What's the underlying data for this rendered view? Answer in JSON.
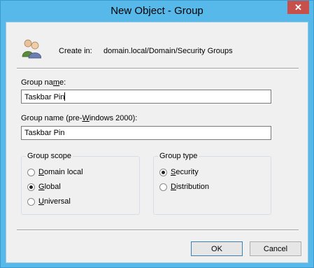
{
  "window": {
    "title": "New Object - Group",
    "close_glyph": "✕"
  },
  "header": {
    "icon": "users-group-icon",
    "create_in_label": "Create in:",
    "create_in_value": "domain.local/Domain/Security Groups"
  },
  "group_name": {
    "label_pre": "Group na",
    "label_u": "m",
    "label_post": "e:",
    "value": "Taskbar Pin"
  },
  "group_name_pre2000": {
    "label_pre": "Group name (pre-",
    "label_u": "W",
    "label_post": "indows 2000):",
    "value": "Taskbar Pin"
  },
  "group_scope": {
    "legend": "Group scope",
    "options": [
      {
        "u": "D",
        "rest": "omain local",
        "selected": false
      },
      {
        "u": "G",
        "rest": "lobal",
        "selected": true
      },
      {
        "u": "U",
        "rest": "niversal",
        "selected": false
      }
    ]
  },
  "group_type": {
    "legend": "Group type",
    "options": [
      {
        "u": "S",
        "rest": "ecurity",
        "selected": true
      },
      {
        "u": "D",
        "rest": "istribution",
        "selected": false
      }
    ]
  },
  "buttons": {
    "ok": "OK",
    "cancel": "Cancel"
  }
}
